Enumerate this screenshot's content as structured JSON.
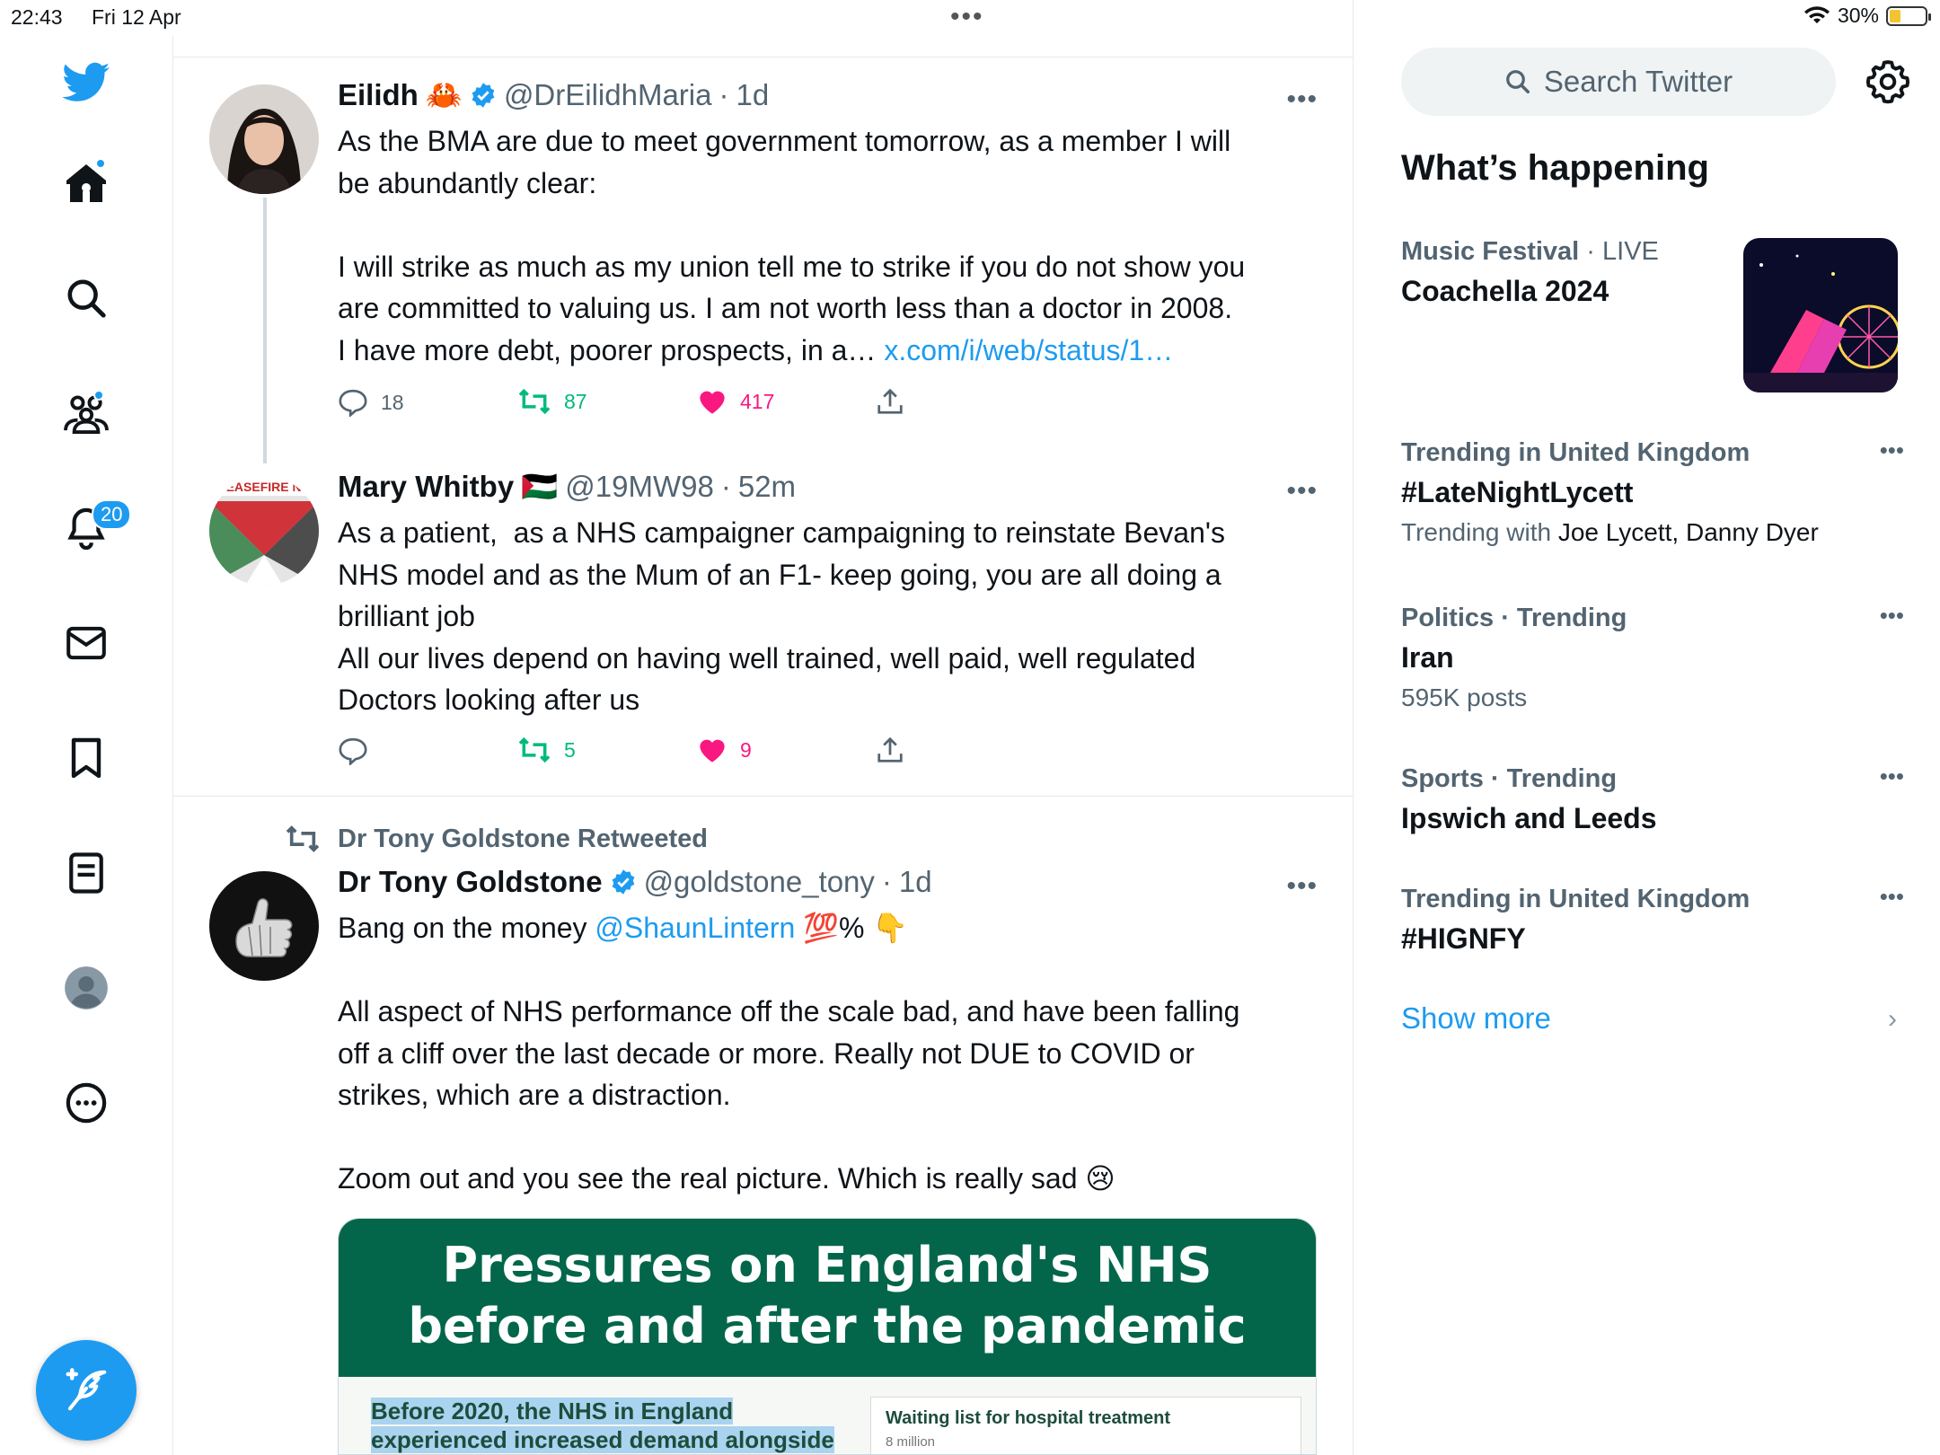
{
  "status_bar": {
    "time": "22:43",
    "date": "Fri 12 Apr",
    "battery": "30%",
    "battery_level": 0.3
  },
  "nav": {
    "notifications_badge": "20",
    "items": [
      "twitter-logo-icon",
      "home-icon",
      "search-icon",
      "communities-icon",
      "notifications-icon",
      "messages-icon",
      "bookmarks-icon",
      "lists-icon",
      "profile-icon",
      "more-icon"
    ]
  },
  "colors": {
    "accent": "#1d9bf0",
    "retweet": "#00ba7c",
    "like": "#f91880",
    "muted": "#536471"
  },
  "tweets": [
    {
      "name": "Eilidh",
      "name_emoji": "🦀",
      "handle": "@DrEilidhMaria",
      "sep": "·",
      "time": "1d",
      "text_main": "As the BMA are due to meet government tomorrow, as a member I will\nbe abundantly clear:\n\nI will strike as much as my union tell me to strike if you do not show you\nare committed to valuing us. I am not worth less than a doctor in 2008.\nI have more debt, poorer prospects, in a… ",
      "link": "x.com/i/web/status/1…",
      "replies": "18",
      "retweets": "87",
      "likes": "417"
    },
    {
      "name": "Mary Whitby",
      "name_emoji": "🇵🇸",
      "handle": "@19MW98",
      "sep": "·",
      "time": "52m",
      "avatar_text": "CEASEFIRE NO",
      "text_main": "As a patient,  as a NHS campaigner campaigning to reinstate Bevan's\nNHS model and as the Mum of an F1- keep going, you are all doing a\nbrilliant job\nAll our lives depend on having well trained, well paid, well regulated\nDoctors looking after us",
      "replies": "",
      "retweets": "5",
      "likes": "9"
    },
    {
      "retweeted_by": "Dr Tony Goldstone Retweeted",
      "name": "Dr Tony Goldstone",
      "handle": "@goldstone_tony",
      "sep": "·",
      "time": "1d",
      "text_pre": "Bang on the money ",
      "mention": "@ShaunLintern",
      "text_post": " 💯% 👇",
      "text_rest": "All aspect of NHS performance off the scale bad, and have been falling\noff a cliff over the last decade or more. Really not DUE to COVID or\nstrikes, which are a distraction.\n\nZoom out and you see the real picture. Which is really sad 😢",
      "media": {
        "title_line1": "Pressures on England's NHS",
        "title_line2": "before and after the pandemic",
        "left_line1": "Before 2020, the NHS in England",
        "left_line2": "experienced increased demand alongside",
        "chart_title": "Waiting list for hospital treatment",
        "chart_unit": "8  million"
      }
    }
  ],
  "sidebar": {
    "search_placeholder": "Search Twitter",
    "heading": "What’s happening",
    "trends": [
      {
        "category": "Music Festival",
        "sep": " · ",
        "meta_extra": "LIVE",
        "title": "Coachella 2024",
        "has_image": true
      },
      {
        "category": "Trending in United Kingdom",
        "title": "#LateNightLycett",
        "sub_prefix": "Trending with ",
        "sub_names": "Joe Lycett, Danny Dyer"
      },
      {
        "category": "Politics · Trending",
        "title": "Iran",
        "sub": "595K posts"
      },
      {
        "category": "Sports · Trending",
        "title": "Ipswich and Leeds"
      },
      {
        "category": "Trending in United Kingdom",
        "title": "#HIGNFY"
      }
    ],
    "show_more": "Show more"
  }
}
